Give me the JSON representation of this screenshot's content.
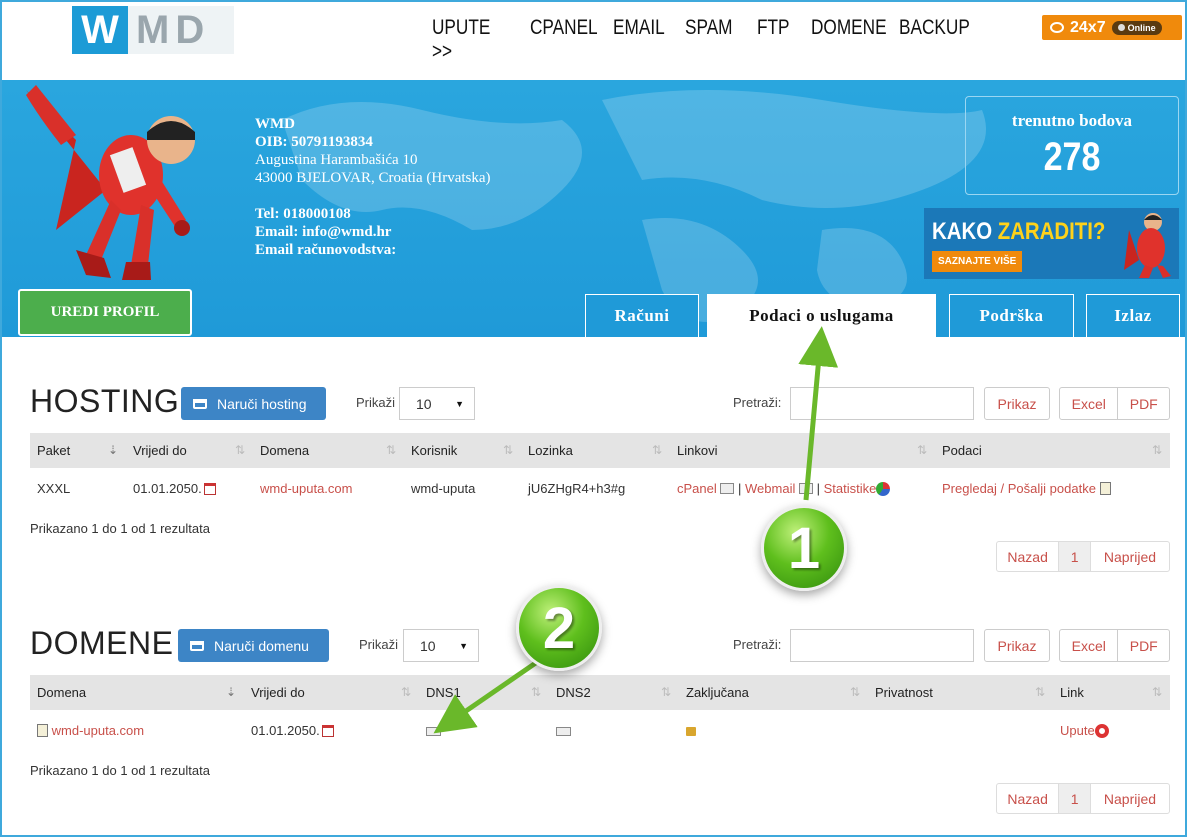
{
  "logo": {
    "w": "W",
    "md": "MD"
  },
  "nav": [
    "UPUTE >>",
    "CPANEL",
    "EMAIL",
    "SPAM",
    "FTP",
    "DOMENE",
    "BACKUP"
  ],
  "chat": {
    "label": "24x7",
    "status": "Online"
  },
  "company": {
    "name": "WMD",
    "oib": "OIB: 50791193834",
    "address": "Augustina Harambašića 10",
    "city": "43000 BJELOVAR, Croatia (Hrvatska)",
    "tel": "Tel: 018000108",
    "email": "Email: info@wmd.hr",
    "email_acc": "Email računovodstva:"
  },
  "points": {
    "label": "trenutno bodova",
    "value": "278"
  },
  "promo": {
    "title_a": "KAKO ",
    "title_b": "ZARADITI?",
    "button": "SAZNAJTE VIŠE"
  },
  "edit_profile": "UREDI PROFIL",
  "tabs": {
    "racuni": "Računi",
    "podaci": "Podaci o uslugama",
    "podrska": "Podrška",
    "izlaz": "Izlaz"
  },
  "hosting": {
    "title": "HOSTING",
    "order_button": "Naruči hosting",
    "show_label": "Prikaži",
    "show_value": "10",
    "search_label": "Pretraži:",
    "search_value": "",
    "show_button": "Prikaz",
    "excel": "Excel",
    "pdf": "PDF",
    "columns": [
      "Paket",
      "Vrijedi do",
      "Domena",
      "Korisnik",
      "Lozinka",
      "Linkovi",
      "Podaci"
    ],
    "row": {
      "paket": "XXXL",
      "vrijedi": "01.01.2050.",
      "domena": "wmd-uputa.com",
      "korisnik": "wmd-uputa",
      "lozinka": "jU6ZHgR4+h3#g",
      "cpanel": "cPanel",
      "sep1": "|",
      "webmail": "Webmail",
      "sep2": "|",
      "statistike": "Statistike",
      "podaci": "Pregledaj / Pošalji podatke"
    },
    "info": "Prikazano 1 do 1 od 1 rezultata",
    "pager": {
      "prev": "Nazad",
      "page": "1",
      "next": "Naprijed"
    }
  },
  "domene": {
    "title": "DOMENE",
    "order_button": "Naruči domenu",
    "show_label": "Prikaži",
    "show_value": "10",
    "search_label": "Pretraži:",
    "search_value": "",
    "show_button": "Prikaz",
    "excel": "Excel",
    "pdf": "PDF",
    "columns": [
      "Domena",
      "Vrijedi do",
      "DNS1",
      "DNS2",
      "Zaključana",
      "Privatnost",
      "Link"
    ],
    "row": {
      "domena": "wmd-uputa.com",
      "vrijedi": "01.01.2050.",
      "link": "Upute"
    },
    "info": "Prikazano 1 do 1 od 1 rezultata",
    "pager": {
      "prev": "Nazad",
      "page": "1",
      "next": "Naprijed"
    }
  },
  "annotations": {
    "one": "1",
    "two": "2"
  }
}
